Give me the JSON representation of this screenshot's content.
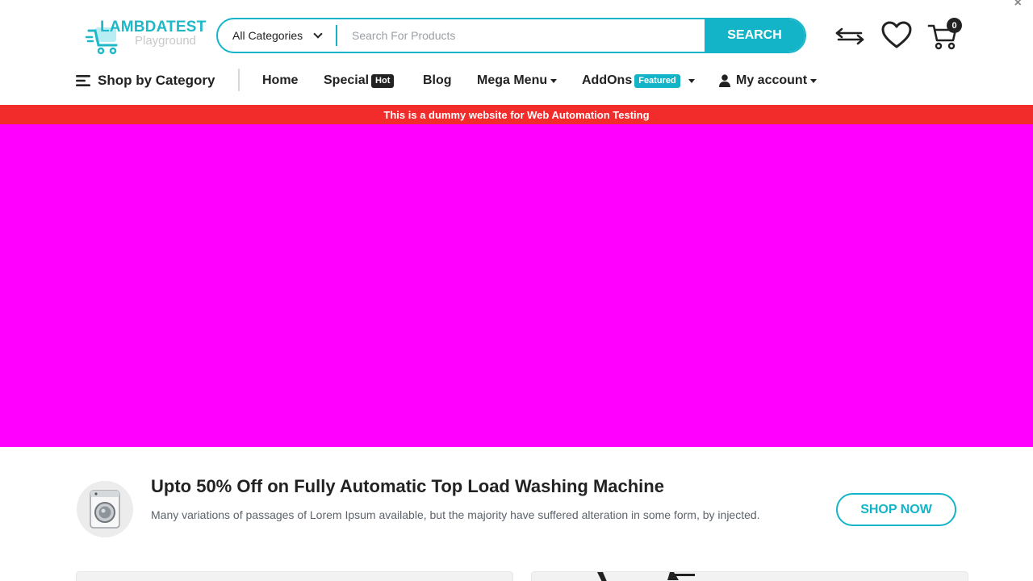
{
  "window": {
    "close_label": "×"
  },
  "header": {
    "logo": {
      "brand": "LAMBDATEST",
      "sub": "Playground"
    },
    "search": {
      "category": "All Categories",
      "placeholder": "Search For Products",
      "button_label": "SEARCH"
    },
    "icons": {
      "compare": "compare-arrows-icon",
      "wishlist": "heart-icon",
      "cart": "cart-icon"
    },
    "cart_count": "0"
  },
  "nav": {
    "shop_by_category": "Shop by Category",
    "home": "Home",
    "special": "Special",
    "special_badge": "Hot",
    "blog": "Blog",
    "mega_menu": "Mega Menu",
    "addons": "AddOns",
    "addons_badge": "Featured",
    "my_account": "My account"
  },
  "notice": "This is a dummy website for Web Automation Testing",
  "hero": {
    "color": "#ff00ff"
  },
  "promo": {
    "title": "Upto 50% Off on Fully Automatic Top Load Washing Machine",
    "description": "Many variations of passages of Lorem Ipsum available, but the majority have suffered alteration in some form, by injected.",
    "button_label": "SHOP NOW"
  },
  "colors": {
    "accent": "#14b4c8",
    "notice_bg": "#f22b2b",
    "text": "#222222"
  }
}
